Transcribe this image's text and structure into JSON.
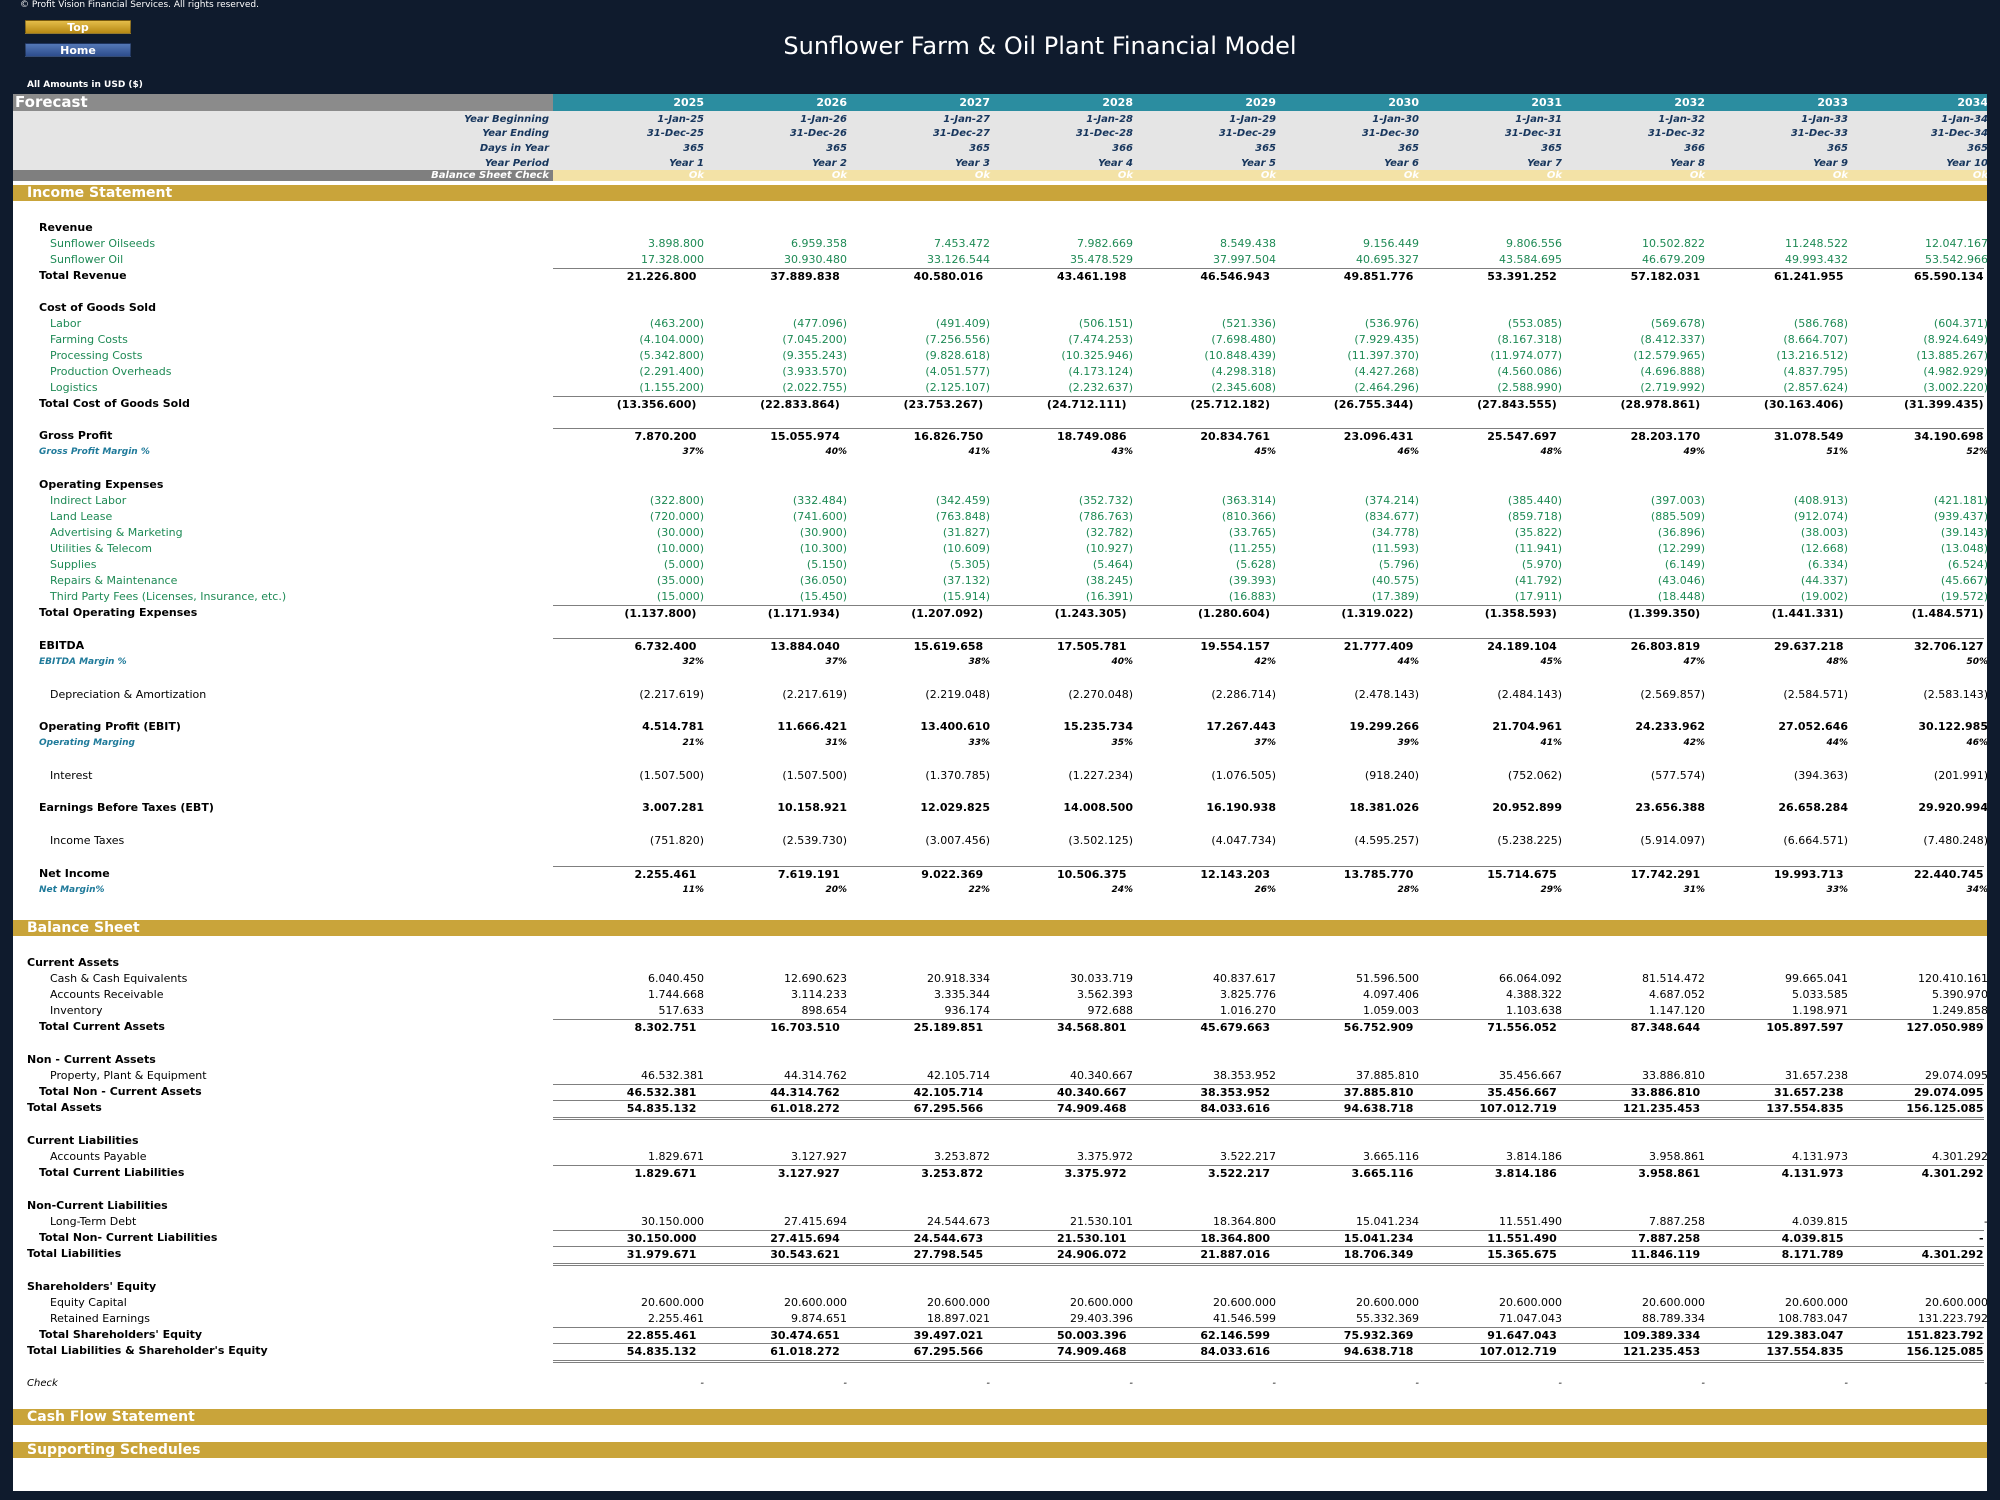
{
  "copyright": "© Profit Vision Financial Services. All rights reserved.",
  "nav": {
    "top": "Top",
    "home": "Home"
  },
  "title": "Sunflower Farm & Oil Plant Financial Model",
  "amounts_note": "All Amounts in  USD ($)",
  "forecast_label": "Forecast",
  "years": [
    "2025",
    "2026",
    "2027",
    "2028",
    "2029",
    "2030",
    "2031",
    "2032",
    "2033",
    "2034"
  ],
  "meta": {
    "year_beginning": {
      "label": "Year Beginning",
      "values": [
        "1-Jan-25",
        "1-Jan-26",
        "1-Jan-27",
        "1-Jan-28",
        "1-Jan-29",
        "1-Jan-30",
        "1-Jan-31",
        "1-Jan-32",
        "1-Jan-33",
        "1-Jan-34"
      ]
    },
    "year_ending": {
      "label": "Year Ending",
      "values": [
        "31-Dec-25",
        "31-Dec-26",
        "31-Dec-27",
        "31-Dec-28",
        "31-Dec-29",
        "31-Dec-30",
        "31-Dec-31",
        "31-Dec-32",
        "31-Dec-33",
        "31-Dec-34"
      ]
    },
    "days": {
      "label": "Days in Year",
      "values": [
        "365",
        "365",
        "365",
        "366",
        "365",
        "365",
        "365",
        "366",
        "365",
        "365"
      ]
    },
    "period": {
      "label": "Year Period",
      "values": [
        "Year 1",
        "Year 2",
        "Year 3",
        "Year 4",
        "Year 5",
        "Year 6",
        "Year 7",
        "Year 8",
        "Year 9",
        "Year 10"
      ]
    },
    "bs_check": {
      "label": "Balance Sheet Check",
      "values": [
        "Ok",
        "Ok",
        "Ok",
        "Ok",
        "Ok",
        "Ok",
        "Ok",
        "Ok",
        "Ok",
        "Ok"
      ]
    }
  },
  "sections": {
    "income": "Income Statement",
    "balance": "Balance Sheet",
    "cashflow": "Cash Flow Statement",
    "supporting": "Supporting Schedules"
  },
  "income": {
    "revenue_header": "Revenue",
    "oilseeds": {
      "label": "Sunflower Oilseeds",
      "values": [
        "3.898.800",
        "6.959.358",
        "7.453.472",
        "7.982.669",
        "8.549.438",
        "9.156.449",
        "9.806.556",
        "10.502.822",
        "11.248.522",
        "12.047.167"
      ]
    },
    "oil": {
      "label": "Sunflower Oil",
      "values": [
        "17.328.000",
        "30.930.480",
        "33.126.544",
        "35.478.529",
        "37.997.504",
        "40.695.327",
        "43.584.695",
        "46.679.209",
        "49.993.432",
        "53.542.966"
      ]
    },
    "total_revenue": {
      "label": "Total Revenue",
      "values": [
        "21.226.800",
        "37.889.838",
        "40.580.016",
        "43.461.198",
        "46.546.943",
        "49.851.776",
        "53.391.252",
        "57.182.031",
        "61.241.955",
        "65.590.134"
      ]
    },
    "cogs_header": "Cost of Goods Sold",
    "labor": {
      "label": "Labor",
      "values": [
        "(463.200)",
        "(477.096)",
        "(491.409)",
        "(506.151)",
        "(521.336)",
        "(536.976)",
        "(553.085)",
        "(569.678)",
        "(586.768)",
        "(604.371)"
      ]
    },
    "farming": {
      "label": "Farming Costs",
      "values": [
        "(4.104.000)",
        "(7.045.200)",
        "(7.256.556)",
        "(7.474.253)",
        "(7.698.480)",
        "(7.929.435)",
        "(8.167.318)",
        "(8.412.337)",
        "(8.664.707)",
        "(8.924.649)"
      ]
    },
    "processing": {
      "label": "Processing Costs",
      "values": [
        "(5.342.800)",
        "(9.355.243)",
        "(9.828.618)",
        "(10.325.946)",
        "(10.848.439)",
        "(11.397.370)",
        "(11.974.077)",
        "(12.579.965)",
        "(13.216.512)",
        "(13.885.267)"
      ]
    },
    "overheads": {
      "label": "Production Overheads",
      "values": [
        "(2.291.400)",
        "(3.933.570)",
        "(4.051.577)",
        "(4.173.124)",
        "(4.298.318)",
        "(4.427.268)",
        "(4.560.086)",
        "(4.696.888)",
        "(4.837.795)",
        "(4.982.929)"
      ]
    },
    "logistics": {
      "label": "Logistics",
      "values": [
        "(1.155.200)",
        "(2.022.755)",
        "(2.125.107)",
        "(2.232.637)",
        "(2.345.608)",
        "(2.464.296)",
        "(2.588.990)",
        "(2.719.992)",
        "(2.857.624)",
        "(3.002.220)"
      ]
    },
    "total_cogs": {
      "label": "Total Cost of Goods Sold",
      "values": [
        "(13.356.600)",
        "(22.833.864)",
        "(23.753.267)",
        "(24.712.111)",
        "(25.712.182)",
        "(26.755.344)",
        "(27.843.555)",
        "(28.978.861)",
        "(30.163.406)",
        "(31.399.435)"
      ]
    },
    "gross_profit": {
      "label": "Gross Profit",
      "values": [
        "7.870.200",
        "15.055.974",
        "16.826.750",
        "18.749.086",
        "20.834.761",
        "23.096.431",
        "25.547.697",
        "28.203.170",
        "31.078.549",
        "34.190.698"
      ]
    },
    "gross_margin": {
      "label": "Gross Profit Margin %",
      "values": [
        "37%",
        "40%",
        "41%",
        "43%",
        "45%",
        "46%",
        "48%",
        "49%",
        "51%",
        "52%"
      ]
    },
    "opex_header": "Operating Expenses",
    "indirect_labor": {
      "label": "Indirect Labor",
      "values": [
        "(322.800)",
        "(332.484)",
        "(342.459)",
        "(352.732)",
        "(363.314)",
        "(374.214)",
        "(385.440)",
        "(397.003)",
        "(408.913)",
        "(421.181)"
      ]
    },
    "land_lease": {
      "label": "Land Lease",
      "values": [
        "(720.000)",
        "(741.600)",
        "(763.848)",
        "(786.763)",
        "(810.366)",
        "(834.677)",
        "(859.718)",
        "(885.509)",
        "(912.074)",
        "(939.437)"
      ]
    },
    "advertising": {
      "label": "Advertising & Marketing",
      "values": [
        "(30.000)",
        "(30.900)",
        "(31.827)",
        "(32.782)",
        "(33.765)",
        "(34.778)",
        "(35.822)",
        "(36.896)",
        "(38.003)",
        "(39.143)"
      ]
    },
    "utilities": {
      "label": "Utilities & Telecom",
      "values": [
        "(10.000)",
        "(10.300)",
        "(10.609)",
        "(10.927)",
        "(11.255)",
        "(11.593)",
        "(11.941)",
        "(12.299)",
        "(12.668)",
        "(13.048)"
      ]
    },
    "supplies": {
      "label": "Supplies",
      "values": [
        "(5.000)",
        "(5.150)",
        "(5.305)",
        "(5.464)",
        "(5.628)",
        "(5.796)",
        "(5.970)",
        "(6.149)",
        "(6.334)",
        "(6.524)"
      ]
    },
    "repairs": {
      "label": "Repairs & Maintenance",
      "values": [
        "(35.000)",
        "(36.050)",
        "(37.132)",
        "(38.245)",
        "(39.393)",
        "(40.575)",
        "(41.792)",
        "(43.046)",
        "(44.337)",
        "(45.667)"
      ]
    },
    "third_party": {
      "label": "Third Party Fees (Licenses, Insurance, etc.)",
      "values": [
        "(15.000)",
        "(15.450)",
        "(15.914)",
        "(16.391)",
        "(16.883)",
        "(17.389)",
        "(17.911)",
        "(18.448)",
        "(19.002)",
        "(19.572)"
      ]
    },
    "total_opex": {
      "label": "Total Operating Expenses",
      "values": [
        "(1.137.800)",
        "(1.171.934)",
        "(1.207.092)",
        "(1.243.305)",
        "(1.280.604)",
        "(1.319.022)",
        "(1.358.593)",
        "(1.399.350)",
        "(1.441.331)",
        "(1.484.571)"
      ]
    },
    "ebitda": {
      "label": "EBITDA",
      "values": [
        "6.732.400",
        "13.884.040",
        "15.619.658",
        "17.505.781",
        "19.554.157",
        "21.777.409",
        "24.189.104",
        "26.803.819",
        "29.637.218",
        "32.706.127"
      ]
    },
    "ebitda_margin": {
      "label": "EBITDA Margin %",
      "values": [
        "32%",
        "37%",
        "38%",
        "40%",
        "42%",
        "44%",
        "45%",
        "47%",
        "48%",
        "50%"
      ]
    },
    "depreciation": {
      "label": "Depreciation & Amortization",
      "values": [
        "(2.217.619)",
        "(2.217.619)",
        "(2.219.048)",
        "(2.270.048)",
        "(2.286.714)",
        "(2.478.143)",
        "(2.484.143)",
        "(2.569.857)",
        "(2.584.571)",
        "(2.583.143)"
      ]
    },
    "ebit": {
      "label": "Operating Profit (EBIT)",
      "values": [
        "4.514.781",
        "11.666.421",
        "13.400.610",
        "15.235.734",
        "17.267.443",
        "19.299.266",
        "21.704.961",
        "24.233.962",
        "27.052.646",
        "30.122.985"
      ]
    },
    "op_margin": {
      "label": "Operating Marging",
      "values": [
        "21%",
        "31%",
        "33%",
        "35%",
        "37%",
        "39%",
        "41%",
        "42%",
        "44%",
        "46%"
      ]
    },
    "interest": {
      "label": "Interest",
      "values": [
        "(1.507.500)",
        "(1.507.500)",
        "(1.370.785)",
        "(1.227.234)",
        "(1.076.505)",
        "(918.240)",
        "(752.062)",
        "(577.574)",
        "(394.363)",
        "(201.991)"
      ]
    },
    "ebt": {
      "label": "Earnings Before Taxes (EBT)",
      "values": [
        "3.007.281",
        "10.158.921",
        "12.029.825",
        "14.008.500",
        "16.190.938",
        "18.381.026",
        "20.952.899",
        "23.656.388",
        "26.658.284",
        "29.920.994"
      ]
    },
    "taxes": {
      "label": "Income Taxes",
      "values": [
        "(751.820)",
        "(2.539.730)",
        "(3.007.456)",
        "(3.502.125)",
        "(4.047.734)",
        "(4.595.257)",
        "(5.238.225)",
        "(5.914.097)",
        "(6.664.571)",
        "(7.480.248)"
      ]
    },
    "net_income": {
      "label": "Net Income",
      "values": [
        "2.255.461",
        "7.619.191",
        "9.022.369",
        "10.506.375",
        "12.143.203",
        "13.785.770",
        "15.714.675",
        "17.742.291",
        "19.993.713",
        "22.440.745"
      ]
    },
    "net_margin": {
      "label": "Net Margin%",
      "values": [
        "11%",
        "20%",
        "22%",
        "24%",
        "26%",
        "28%",
        "29%",
        "31%",
        "33%",
        "34%"
      ]
    }
  },
  "balance": {
    "ca_header": "Current Assets",
    "cash": {
      "label": "Cash & Cash Equivalents",
      "values": [
        "6.040.450",
        "12.690.623",
        "20.918.334",
        "30.033.719",
        "40.837.617",
        "51.596.500",
        "66.064.092",
        "81.514.472",
        "99.665.041",
        "120.410.161"
      ]
    },
    "ar": {
      "label": "Accounts Receivable",
      "values": [
        "1.744.668",
        "3.114.233",
        "3.335.344",
        "3.562.393",
        "3.825.776",
        "4.097.406",
        "4.388.322",
        "4.687.052",
        "5.033.585",
        "5.390.970"
      ]
    },
    "inventory": {
      "label": "Inventory",
      "values": [
        "517.633",
        "898.654",
        "936.174",
        "972.688",
        "1.016.270",
        "1.059.003",
        "1.103.638",
        "1.147.120",
        "1.198.971",
        "1.249.858"
      ]
    },
    "total_ca": {
      "label": "Total Current Assets",
      "values": [
        "8.302.751",
        "16.703.510",
        "25.189.851",
        "34.568.801",
        "45.679.663",
        "56.752.909",
        "71.556.052",
        "87.348.644",
        "105.897.597",
        "127.050.989"
      ]
    },
    "nca_header": "Non - Current Assets",
    "ppe": {
      "label": "Property, Plant & Equipment",
      "values": [
        "46.532.381",
        "44.314.762",
        "42.105.714",
        "40.340.667",
        "38.353.952",
        "37.885.810",
        "35.456.667",
        "33.886.810",
        "31.657.238",
        "29.074.095"
      ]
    },
    "total_nca": {
      "label": "Total Non - Current Assets",
      "values": [
        "46.532.381",
        "44.314.762",
        "42.105.714",
        "40.340.667",
        "38.353.952",
        "37.885.810",
        "35.456.667",
        "33.886.810",
        "31.657.238",
        "29.074.095"
      ]
    },
    "total_assets": {
      "label": "Total Assets",
      "values": [
        "54.835.132",
        "61.018.272",
        "67.295.566",
        "74.909.468",
        "84.033.616",
        "94.638.718",
        "107.012.719",
        "121.235.453",
        "137.554.835",
        "156.125.085"
      ]
    },
    "cl_header": "Current Liabilities",
    "ap": {
      "label": "Accounts Payable",
      "values": [
        "1.829.671",
        "3.127.927",
        "3.253.872",
        "3.375.972",
        "3.522.217",
        "3.665.116",
        "3.814.186",
        "3.958.861",
        "4.131.973",
        "4.301.292"
      ]
    },
    "total_cl": {
      "label": "Total Current Liabilities",
      "values": [
        "1.829.671",
        "3.127.927",
        "3.253.872",
        "3.375.972",
        "3.522.217",
        "3.665.116",
        "3.814.186",
        "3.958.861",
        "4.131.973",
        "4.301.292"
      ]
    },
    "ncl_header": "Non-Current Liabilities",
    "ltd": {
      "label": "Long-Term Debt",
      "values": [
        "30.150.000",
        "27.415.694",
        "24.544.673",
        "21.530.101",
        "18.364.800",
        "15.041.234",
        "11.551.490",
        "7.887.258",
        "4.039.815",
        "-"
      ]
    },
    "total_ncl": {
      "label": "Total Non- Current Liabilities",
      "values": [
        "30.150.000",
        "27.415.694",
        "24.544.673",
        "21.530.101",
        "18.364.800",
        "15.041.234",
        "11.551.490",
        "7.887.258",
        "4.039.815",
        "-"
      ]
    },
    "total_liab": {
      "label": "Total Liabilities",
      "values": [
        "31.979.671",
        "30.543.621",
        "27.798.545",
        "24.906.072",
        "21.887.016",
        "18.706.349",
        "15.365.675",
        "11.846.119",
        "8.171.789",
        "4.301.292"
      ]
    },
    "eq_header": "Shareholders' Equity",
    "equity_capital": {
      "label": "Equity Capital",
      "values": [
        "20.600.000",
        "20.600.000",
        "20.600.000",
        "20.600.000",
        "20.600.000",
        "20.600.000",
        "20.600.000",
        "20.600.000",
        "20.600.000",
        "20.600.000"
      ]
    },
    "retained": {
      "label": "Retained Earnings",
      "values": [
        "2.255.461",
        "9.874.651",
        "18.897.021",
        "29.403.396",
        "41.546.599",
        "55.332.369",
        "71.047.043",
        "88.789.334",
        "108.783.047",
        "131.223.792"
      ]
    },
    "total_equity": {
      "label": "Total Shareholders' Equity",
      "values": [
        "22.855.461",
        "30.474.651",
        "39.497.021",
        "50.003.396",
        "62.146.599",
        "75.932.369",
        "91.647.043",
        "109.389.334",
        "129.383.047",
        "151.823.792"
      ]
    },
    "total_le": {
      "label": "Total Liabilities & Shareholder's Equity",
      "values": [
        "54.835.132",
        "61.018.272",
        "67.295.566",
        "74.909.468",
        "84.033.616",
        "94.638.718",
        "107.012.719",
        "121.235.453",
        "137.554.835",
        "156.125.085"
      ]
    },
    "check": {
      "label": "Check",
      "values": [
        "-",
        "-",
        "-",
        "-",
        "-",
        "-",
        "-",
        "-",
        "-",
        "-"
      ]
    }
  }
}
